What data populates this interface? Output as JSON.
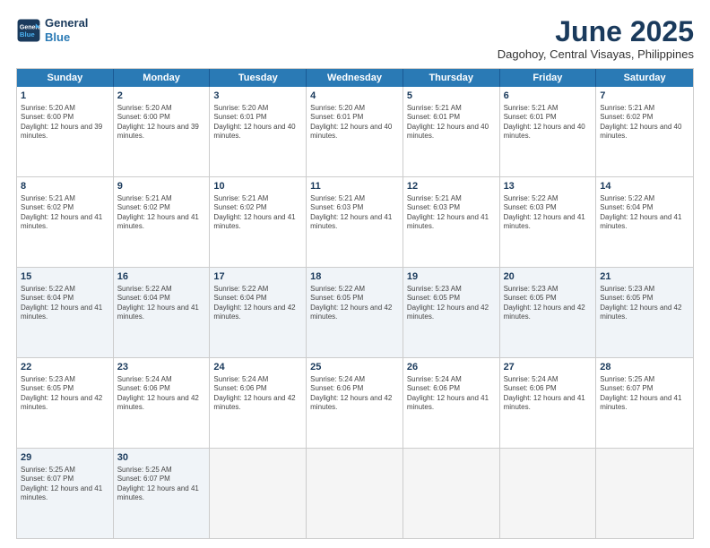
{
  "header": {
    "logo_line1": "General",
    "logo_line2": "Blue",
    "month": "June 2025",
    "location": "Dagohoy, Central Visayas, Philippines"
  },
  "weekdays": [
    "Sunday",
    "Monday",
    "Tuesday",
    "Wednesday",
    "Thursday",
    "Friday",
    "Saturday"
  ],
  "rows": [
    [
      {
        "day": "",
        "sunrise": "",
        "sunset": "",
        "daylight": "",
        "empty": true
      },
      {
        "day": "2",
        "sunrise": "Sunrise: 5:20 AM",
        "sunset": "Sunset: 6:00 PM",
        "daylight": "Daylight: 12 hours and 39 minutes."
      },
      {
        "day": "3",
        "sunrise": "Sunrise: 5:20 AM",
        "sunset": "Sunset: 6:01 PM",
        "daylight": "Daylight: 12 hours and 40 minutes."
      },
      {
        "day": "4",
        "sunrise": "Sunrise: 5:20 AM",
        "sunset": "Sunset: 6:01 PM",
        "daylight": "Daylight: 12 hours and 40 minutes."
      },
      {
        "day": "5",
        "sunrise": "Sunrise: 5:21 AM",
        "sunset": "Sunset: 6:01 PM",
        "daylight": "Daylight: 12 hours and 40 minutes."
      },
      {
        "day": "6",
        "sunrise": "Sunrise: 5:21 AM",
        "sunset": "Sunset: 6:01 PM",
        "daylight": "Daylight: 12 hours and 40 minutes."
      },
      {
        "day": "7",
        "sunrise": "Sunrise: 5:21 AM",
        "sunset": "Sunset: 6:02 PM",
        "daylight": "Daylight: 12 hours and 40 minutes."
      }
    ],
    [
      {
        "day": "8",
        "sunrise": "Sunrise: 5:21 AM",
        "sunset": "Sunset: 6:02 PM",
        "daylight": "Daylight: 12 hours and 41 minutes."
      },
      {
        "day": "9",
        "sunrise": "Sunrise: 5:21 AM",
        "sunset": "Sunset: 6:02 PM",
        "daylight": "Daylight: 12 hours and 41 minutes."
      },
      {
        "day": "10",
        "sunrise": "Sunrise: 5:21 AM",
        "sunset": "Sunset: 6:02 PM",
        "daylight": "Daylight: 12 hours and 41 minutes."
      },
      {
        "day": "11",
        "sunrise": "Sunrise: 5:21 AM",
        "sunset": "Sunset: 6:03 PM",
        "daylight": "Daylight: 12 hours and 41 minutes."
      },
      {
        "day": "12",
        "sunrise": "Sunrise: 5:21 AM",
        "sunset": "Sunset: 6:03 PM",
        "daylight": "Daylight: 12 hours and 41 minutes."
      },
      {
        "day": "13",
        "sunrise": "Sunrise: 5:22 AM",
        "sunset": "Sunset: 6:03 PM",
        "daylight": "Daylight: 12 hours and 41 minutes."
      },
      {
        "day": "14",
        "sunrise": "Sunrise: 5:22 AM",
        "sunset": "Sunset: 6:04 PM",
        "daylight": "Daylight: 12 hours and 41 minutes."
      }
    ],
    [
      {
        "day": "15",
        "sunrise": "Sunrise: 5:22 AM",
        "sunset": "Sunset: 6:04 PM",
        "daylight": "Daylight: 12 hours and 41 minutes."
      },
      {
        "day": "16",
        "sunrise": "Sunrise: 5:22 AM",
        "sunset": "Sunset: 6:04 PM",
        "daylight": "Daylight: 12 hours and 41 minutes."
      },
      {
        "day": "17",
        "sunrise": "Sunrise: 5:22 AM",
        "sunset": "Sunset: 6:04 PM",
        "daylight": "Daylight: 12 hours and 42 minutes."
      },
      {
        "day": "18",
        "sunrise": "Sunrise: 5:22 AM",
        "sunset": "Sunset: 6:05 PM",
        "daylight": "Daylight: 12 hours and 42 minutes."
      },
      {
        "day": "19",
        "sunrise": "Sunrise: 5:23 AM",
        "sunset": "Sunset: 6:05 PM",
        "daylight": "Daylight: 12 hours and 42 minutes."
      },
      {
        "day": "20",
        "sunrise": "Sunrise: 5:23 AM",
        "sunset": "Sunset: 6:05 PM",
        "daylight": "Daylight: 12 hours and 42 minutes."
      },
      {
        "day": "21",
        "sunrise": "Sunrise: 5:23 AM",
        "sunset": "Sunset: 6:05 PM",
        "daylight": "Daylight: 12 hours and 42 minutes."
      }
    ],
    [
      {
        "day": "22",
        "sunrise": "Sunrise: 5:23 AM",
        "sunset": "Sunset: 6:05 PM",
        "daylight": "Daylight: 12 hours and 42 minutes."
      },
      {
        "day": "23",
        "sunrise": "Sunrise: 5:24 AM",
        "sunset": "Sunset: 6:06 PM",
        "daylight": "Daylight: 12 hours and 42 minutes."
      },
      {
        "day": "24",
        "sunrise": "Sunrise: 5:24 AM",
        "sunset": "Sunset: 6:06 PM",
        "daylight": "Daylight: 12 hours and 42 minutes."
      },
      {
        "day": "25",
        "sunrise": "Sunrise: 5:24 AM",
        "sunset": "Sunset: 6:06 PM",
        "daylight": "Daylight: 12 hours and 42 minutes."
      },
      {
        "day": "26",
        "sunrise": "Sunrise: 5:24 AM",
        "sunset": "Sunset: 6:06 PM",
        "daylight": "Daylight: 12 hours and 41 minutes."
      },
      {
        "day": "27",
        "sunrise": "Sunrise: 5:24 AM",
        "sunset": "Sunset: 6:06 PM",
        "daylight": "Daylight: 12 hours and 41 minutes."
      },
      {
        "day": "28",
        "sunrise": "Sunrise: 5:25 AM",
        "sunset": "Sunset: 6:07 PM",
        "daylight": "Daylight: 12 hours and 41 minutes."
      }
    ],
    [
      {
        "day": "29",
        "sunrise": "Sunrise: 5:25 AM",
        "sunset": "Sunset: 6:07 PM",
        "daylight": "Daylight: 12 hours and 41 minutes."
      },
      {
        "day": "30",
        "sunrise": "Sunrise: 5:25 AM",
        "sunset": "Sunset: 6:07 PM",
        "daylight": "Daylight: 12 hours and 41 minutes."
      },
      {
        "day": "",
        "sunrise": "",
        "sunset": "",
        "daylight": "",
        "empty": true
      },
      {
        "day": "",
        "sunrise": "",
        "sunset": "",
        "daylight": "",
        "empty": true
      },
      {
        "day": "",
        "sunrise": "",
        "sunset": "",
        "daylight": "",
        "empty": true
      },
      {
        "day": "",
        "sunrise": "",
        "sunset": "",
        "daylight": "",
        "empty": true
      },
      {
        "day": "",
        "sunrise": "",
        "sunset": "",
        "daylight": "",
        "empty": true
      }
    ]
  ],
  "row0_day1": {
    "day": "1",
    "sunrise": "Sunrise: 5:20 AM",
    "sunset": "Sunset: 6:00 PM",
    "daylight": "Daylight: 12 hours and 39 minutes."
  }
}
